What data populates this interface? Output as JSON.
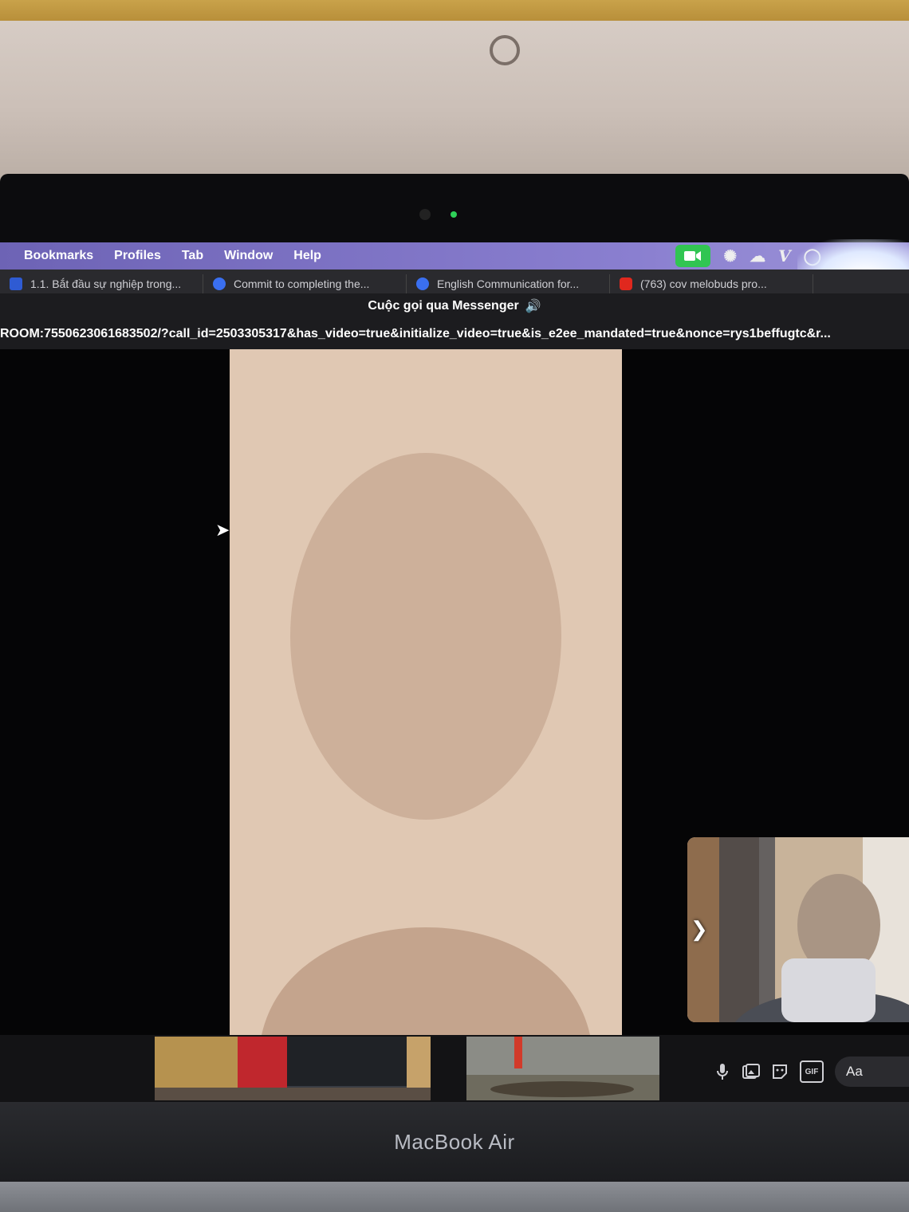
{
  "menubar": {
    "items": [
      "Bookmarks",
      "Profiles",
      "Tab",
      "Window",
      "Help"
    ],
    "status_icons": [
      "video-camera-icon",
      "openai-icon",
      "cloud-icon",
      "v-icon",
      "circle-icon"
    ]
  },
  "tabs": [
    {
      "label": "1.1. Bắt đầu sự nghiệp trong...",
      "favicon_color": "#2f5bd3"
    },
    {
      "label": "Commit to completing the...",
      "favicon_color": "#3a6ff0"
    },
    {
      "label": "English Communication for...",
      "favicon_color": "#3a6ff0"
    },
    {
      "label": "(763) cov melobuds pro...",
      "favicon_color": "#e0281e"
    }
  ],
  "window": {
    "title": "Cuộc gọi qua Messenger",
    "title_icon": "speaker-icon",
    "url": "ROOM:7550623061683502/?call_id=2503305317&has_video=true&initialize_video=true&is_e2ee_mandated=true&nonce=rys1beffugtc&r..."
  },
  "call": {
    "remote_label": "remote-participant-video",
    "self_label": "self-view-video"
  },
  "composer": {
    "icons": [
      "microphone-icon",
      "image-icon",
      "sticker-icon",
      "gif-icon"
    ],
    "gif_text": "GIF",
    "placeholder": "Aa"
  },
  "device": {
    "label": "MacBook Air"
  },
  "colors": {
    "menubar": "#7b71c6",
    "status_video": "#31c552",
    "titlebar": "#1c1c1f"
  }
}
